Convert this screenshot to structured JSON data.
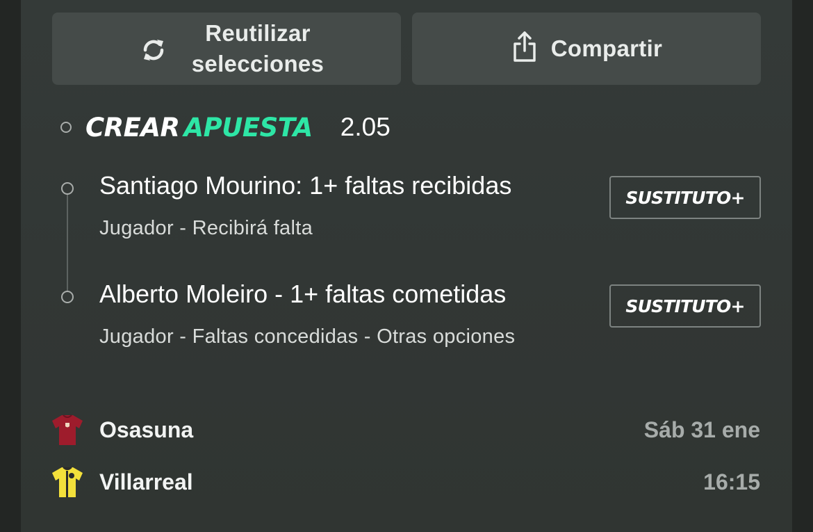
{
  "actions": {
    "reuse_label": "Reutilizar selecciones",
    "reuse_icon": "refresh-icon",
    "share_label": "Compartir",
    "share_icon": "share-icon"
  },
  "bet_builder": {
    "title_main": "CREAR",
    "title_accent": "APUESTA",
    "odds": "2.05",
    "accent_color": "#2ee6a6"
  },
  "selections": [
    {
      "title": "Santiago Mourino: 1+ faltas recibidas",
      "subtitle": "Jugador - Recibirá falta",
      "badge": "SUSTITUTO+"
    },
    {
      "title": "Alberto Moleiro - 1+ faltas cometidas",
      "subtitle": "Jugador - Faltas concedidas - Otras opciones",
      "badge": "SUSTITUTO+"
    }
  ],
  "match": {
    "home_team": "Osasuna",
    "home_shirt_icon": "osasuna-shirt-icon",
    "home_shirt_color": "#9e1c2c",
    "away_team": "Villarreal",
    "away_shirt_icon": "villarreal-shirt-icon",
    "away_shirt_color": "#f3e03b",
    "date": "Sáb 31 ene",
    "time": "16:15"
  }
}
